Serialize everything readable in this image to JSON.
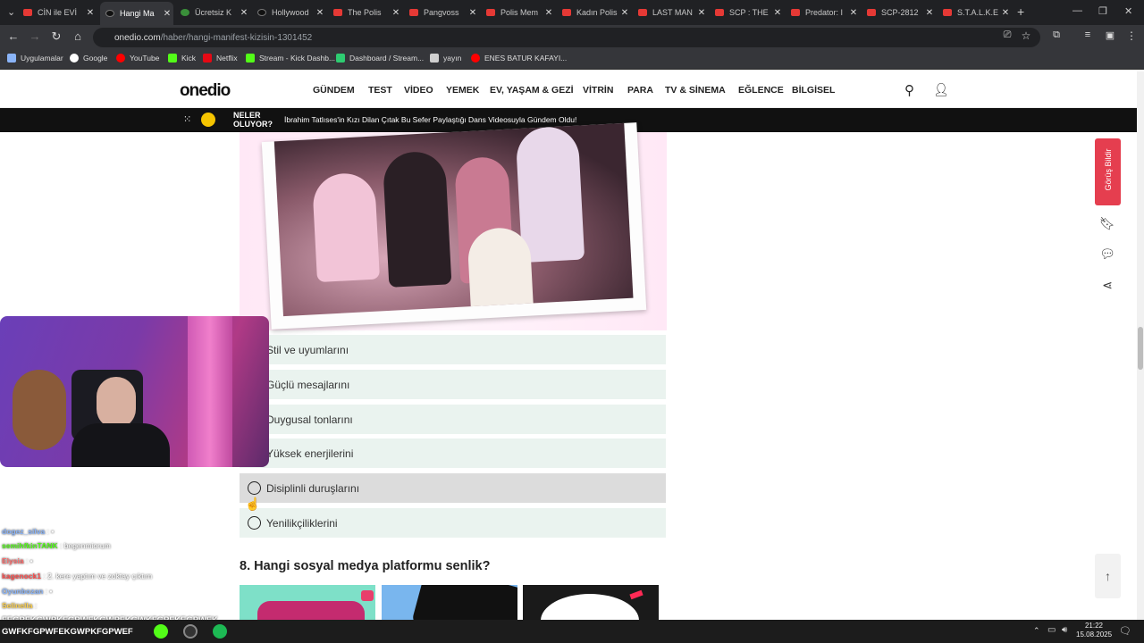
{
  "browser": {
    "tabs": [
      {
        "label": "CİN ile EVİ",
        "icon": "youtube-icon",
        "active": false
      },
      {
        "label": "Hangi Ma",
        "icon": "onedio-icon",
        "active": true
      },
      {
        "label": "Ücretsiz K",
        "icon": "xbox-icon",
        "active": false
      },
      {
        "label": "Hollywood",
        "icon": "onedio-icon",
        "active": false
      },
      {
        "label": "The Polis",
        "icon": "youtube-icon",
        "active": false
      },
      {
        "label": "Pangvoss",
        "icon": "youtube-icon",
        "active": false
      },
      {
        "label": "Polis Mem",
        "icon": "youtube-icon",
        "active": false
      },
      {
        "label": "Kadın Polis",
        "icon": "youtube-icon",
        "active": false
      },
      {
        "label": "LAST MAN",
        "icon": "youtube-icon",
        "active": false
      },
      {
        "label": "SCP : THE",
        "icon": "youtube-icon",
        "active": false
      },
      {
        "label": "Predator: I",
        "icon": "youtube-icon",
        "active": false
      },
      {
        "label": "SCP-2812",
        "icon": "youtube-icon",
        "active": false
      },
      {
        "label": "S.T.A.L.K.E",
        "icon": "youtube-icon",
        "active": false
      }
    ],
    "url_host": "onedio.com",
    "url_path": "/haber/hangi-manifest-kizisin-1301452",
    "bookmarks": [
      {
        "label": "Uygulamalar",
        "icon": "apps-icon",
        "color": "#8ab4f8"
      },
      {
        "label": "Google",
        "icon": "google-icon",
        "color": "#ffffff"
      },
      {
        "label": "YouTube",
        "icon": "youtube-icon",
        "color": "#ff0000"
      },
      {
        "label": "Kick",
        "icon": "kick-icon",
        "color": "#53fc18"
      },
      {
        "label": "Netflix",
        "icon": "netflix-icon",
        "color": "#e50914"
      },
      {
        "label": "Stream - Kick Dashb...",
        "icon": "kick-icon",
        "color": "#53fc18"
      },
      {
        "label": "Dashboard / Stream...",
        "icon": "streamelements-icon",
        "color": "#2ecc71"
      },
      {
        "label": "yayın",
        "icon": "folder-icon",
        "color": "#cfcfcf"
      },
      {
        "label": "ENES BATUR KAFAYI...",
        "icon": "youtube-icon",
        "color": "#ff0000"
      }
    ]
  },
  "site": {
    "logo": "onedio",
    "nav": [
      "GÜNDEM",
      "TEST",
      "VİDEO",
      "YEMEK",
      "EV, YAŞAM & GEZİ",
      "VİTRİN",
      "PARA",
      "TV & SİNEMA",
      "EĞLENCE",
      "BİLGİSEL"
    ],
    "ticker_label_1": "NELER",
    "ticker_label_2": "OLUYOR?",
    "ticker_text": "İbrahim Tatlıses'in Kızı Dilan Çıtak Bu Sefer Paylaştığı Dans Videosuyla Gündem Oldu!",
    "feedback_label": "Görüş Bildir"
  },
  "quiz": {
    "options": [
      "Stil ve uyumlarını",
      "Güçlü mesajlarını",
      "Duygusal tonlarını",
      "Yüksek enerjilerini",
      "Disiplinli duruşlarını",
      "Yenilikçiliklerini"
    ],
    "hovered_index": 4,
    "next_question": "8. Hangi sosyal medya platformu senlik?"
  },
  "chat": [
    {
      "user": "dogez_silva",
      "msg": "▪",
      "color": "#8ab4f8"
    },
    {
      "user": "semihfkinTANK",
      "msg": "begenmiorum",
      "color": "#53fc18"
    },
    {
      "user": "Elysia",
      "msg": "▪",
      "color": "#ff6b6b"
    },
    {
      "user": "kagenock1",
      "msg": "2. kere yaptım ve zoktay çıktım",
      "color": "#ff4d4d"
    },
    {
      "user": "Oyunbozan",
      "msg": "▪",
      "color": "#8ab4f8"
    },
    {
      "user": "Selinella",
      "msg": "",
      "color": "#ffd24d"
    }
  ],
  "overlay_text_1": "FEGPFKGWPKFGPWFKGWPFKGWKFGPFKEGPWFK",
  "overlay_text_2": "GWFKFGPWFEKGWPKFGPWEF",
  "system": {
    "time": "21:22",
    "date": "15.08.2025"
  }
}
